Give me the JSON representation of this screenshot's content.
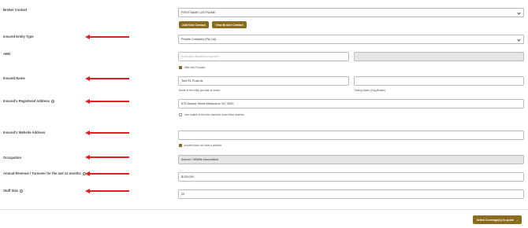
{
  "labels": {
    "broker_contact": "Broker Contact",
    "entity_type": "Insured Entity Type",
    "abn": "ABN",
    "insured_name": "Insured Name",
    "registered_address": "Insured's Registered Address",
    "website": "Insured's Website Address",
    "occupation": "Occupation",
    "revenue": "Annual Revenue / Turnover for the last 12 months",
    "staff_size": "Staff Size"
  },
  "broker_contact": {
    "selected": "FIRSTNAME LASTNAME",
    "add_button": "Add New Contact",
    "view_button": "View Broker Contact"
  },
  "entity_type": {
    "selected": "Private Company (Pty Ltd)"
  },
  "abn": {
    "placeholder": "Australian Business Number",
    "not_provided_label": "ABN Not Provided"
  },
  "insured_name": {
    "value": "Test RL PLab AL",
    "help": "Name of the entity you wish to insure",
    "trading_value": "",
    "trading_help": "Trading Name (if applicable)"
  },
  "registered_address": {
    "value": "575 Bourke Street Melbourne VIC 3000",
    "unable_label": "I am unable to find the insured's head office address"
  },
  "website": {
    "value": "",
    "no_website_label": "Insured does not have a website"
  },
  "occupation": {
    "value": "Animal / Wildlife Association"
  },
  "revenue": {
    "value": "$125,000"
  },
  "staff_size": {
    "value": "25"
  },
  "footer": {
    "submit_label": "Select Coverage(s) to quote",
    "submit_arrow": "→"
  },
  "colors": {
    "accent": "#8a6d1c",
    "annotation_arrow": "#e02020"
  }
}
